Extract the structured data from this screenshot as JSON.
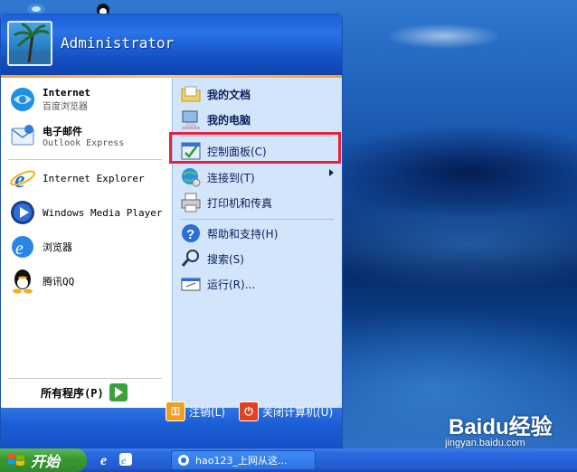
{
  "user": {
    "name": "Administrator"
  },
  "left_items": [
    {
      "title": "Internet",
      "subtitle": "百度浏览器",
      "icon": "browser-icon"
    },
    {
      "title": "电子邮件",
      "subtitle": "Outlook Express",
      "icon": "mail-icon"
    },
    {
      "title": "Internet Explorer",
      "icon": "ie-icon"
    },
    {
      "title": "Windows Media Player",
      "icon": "media-player-icon"
    },
    {
      "title": "浏览器",
      "icon": "browser-icon"
    },
    {
      "title": "腾讯QQ",
      "icon": "qq-icon"
    }
  ],
  "all_programs": "所有程序(P)",
  "right_items": [
    {
      "label": "我的文档",
      "icon": "documents-icon"
    },
    {
      "label": "我的电脑",
      "icon": "computer-icon"
    },
    {
      "label": "控制面板(C)",
      "icon": "control-panel-icon"
    },
    {
      "label": "连接到(T)",
      "icon": "connect-icon"
    },
    {
      "label": "打印机和传真",
      "icon": "printer-icon"
    },
    {
      "label": "帮助和支持(H)",
      "icon": "help-icon"
    },
    {
      "label": "搜索(S)",
      "icon": "search-icon"
    },
    {
      "label": "运行(R)...",
      "icon": "run-icon"
    }
  ],
  "footer": {
    "logoff": "注销(L)",
    "shutdown": "关闭计算机(U)"
  },
  "taskbar": {
    "start": "开始",
    "task": "hao123_上网从这..."
  },
  "watermark": {
    "logo": "Baidu经验",
    "url": "jingyan.baidu.com"
  },
  "colors": {
    "highlight": "#e8223a",
    "header": "#1c5ed6",
    "right_pane": "#d3e5fa"
  }
}
